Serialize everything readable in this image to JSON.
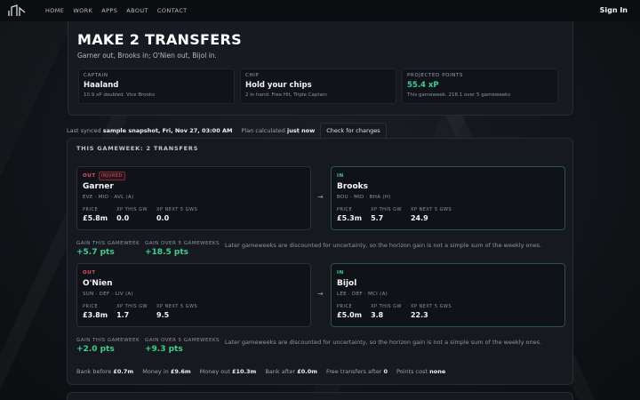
{
  "nav": {
    "links": [
      "HOME",
      "WORK",
      "APPS",
      "ABOUT",
      "CONTACT"
    ],
    "signin": "Sign In"
  },
  "hero": {
    "title": "MAKE 2 TRANSFERS",
    "subtitle": "Garner out, Brooks in; O'Nien out, Bijol in.",
    "stats": [
      {
        "label": "CAPTAIN",
        "value": "Haaland",
        "note": "10.9 xP doubled. Vice Brooks"
      },
      {
        "label": "CHIP",
        "value": "Hold your chips",
        "note": "2 in hand: Free Hit, Triple Captain"
      },
      {
        "label": "PROJECTED POINTS",
        "value": "55.4 xP",
        "note": "This gameweek. 218.1 over 5 gameweeks"
      }
    ]
  },
  "sync": {
    "prefix": "Last synced",
    "snapshot": "sample snapshot, Fri, Nov 27, 03:00 AM",
    "plan_prefix": "Plan calculated",
    "plan_time": "just now",
    "check_button": "Check for changes"
  },
  "plan": {
    "title": "THIS GAMEWEEK: 2 TRANSFERS",
    "arrow": "→",
    "transfers": [
      {
        "out": {
          "tag": "OUT",
          "badge": "INJURED",
          "name": "Garner",
          "meta": "EVE · MID · AVL (A)",
          "labels": [
            "PRICE",
            "XP THIS GW",
            "XP NEXT 5 GWS"
          ],
          "values": [
            "£5.8m",
            "0.0",
            "0.0"
          ]
        },
        "in": {
          "tag": "IN",
          "name": "Brooks",
          "meta": "BOU · MID · BHA (H)",
          "labels": [
            "PRICE",
            "XP THIS GW",
            "XP NEXT 5 GWS"
          ],
          "values": [
            "£5.3m",
            "5.7",
            "24.9"
          ]
        },
        "gain_gw_label": "GAIN THIS GAMEWEEK",
        "gain_gw": "+5.7 pts",
        "gain_5_label": "GAIN OVER 5 GAMEWEEKS",
        "gain_5": "+18.5 pts",
        "note": "Later gameweeks are discounted for uncertainty, so the horizon gain is not a simple sum of the weekly ones."
      },
      {
        "out": {
          "tag": "OUT",
          "name": "O'Nien",
          "meta": "SUN · DEF · LIV (A)",
          "labels": [
            "PRICE",
            "XP THIS GW",
            "XP NEXT 5 GWS"
          ],
          "values": [
            "£3.8m",
            "1.7",
            "9.5"
          ]
        },
        "in": {
          "tag": "IN",
          "name": "Bijol",
          "meta": "LEE · DEF · MCI (A)",
          "labels": [
            "PRICE",
            "XP THIS GW",
            "XP NEXT 5 GWS"
          ],
          "values": [
            "£5.0m",
            "3.8",
            "22.3"
          ]
        },
        "gain_gw_label": "GAIN THIS GAMEWEEK",
        "gain_gw": "+2.0 pts",
        "gain_5_label": "GAIN OVER 5 GAMEWEEKS",
        "gain_5": "+9.3 pts",
        "note": "Later gameweeks are discounted for uncertainty, so the horizon gain is not a simple sum of the weekly ones."
      }
    ],
    "bank": [
      {
        "label": "Bank before",
        "value": "£0.7m"
      },
      {
        "label": "Money in",
        "value": "£9.6m"
      },
      {
        "label": "Money out",
        "value": "£10.3m"
      },
      {
        "label": "Bank after",
        "value": "£0.0m"
      },
      {
        "label": "Free transfers after",
        "value": "0"
      },
      {
        "label": "Points cost",
        "value": "none"
      }
    ]
  },
  "colors": {
    "accent_green": "#3fcf8e",
    "out_red": "#e05468",
    "background": "#0f1216",
    "card": "#161a20"
  }
}
